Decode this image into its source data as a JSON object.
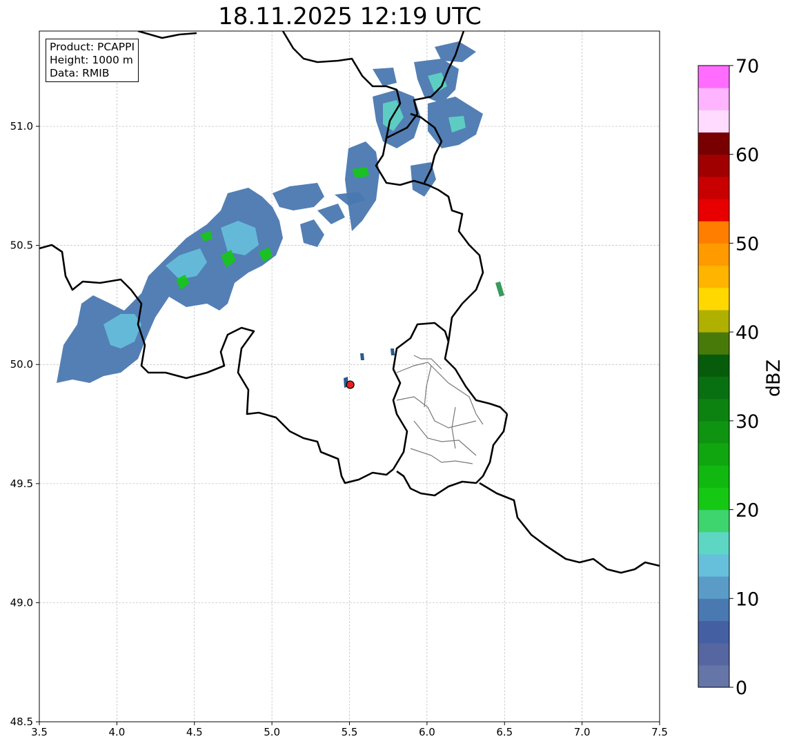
{
  "title": "18.11.2025 12:19 UTC",
  "info_box": [
    "Product: PCAPPI",
    "Height: 1000 m",
    "Data: RMIB"
  ],
  "map": {
    "lon_range": [
      3.5,
      7.5
    ],
    "lat_range": [
      48.5,
      51.4
    ],
    "lon_ticks": [
      3.5,
      4.0,
      4.5,
      5.0,
      5.5,
      6.0,
      6.5,
      7.0,
      7.5
    ],
    "lon_tick_labels": [
      "3.5",
      "4.0",
      "4.5",
      "5.0",
      "5.5",
      "6.0",
      "6.5",
      "7.0",
      "7.5"
    ],
    "lat_ticks": [
      48.5,
      49.0,
      49.5,
      50.0,
      50.5,
      51.0
    ],
    "lat_tick_labels": [
      "48.5",
      "49.0",
      "49.5",
      "50.0",
      "50.5",
      "51.0"
    ],
    "gridlines": true,
    "radar_site": {
      "lon": 5.505,
      "lat": 49.915,
      "color": "#e8201c"
    }
  },
  "colorbar": {
    "label": "dBZ",
    "vmin": 0,
    "vmax": 70,
    "step": 2.5,
    "tick_values": [
      0,
      10,
      20,
      30,
      40,
      50,
      60,
      70
    ],
    "tick_labels": [
      "0",
      "10",
      "20",
      "30",
      "40",
      "50",
      "60",
      "70"
    ],
    "colors": [
      "#6675a8",
      "#5566a0",
      "#4460a3",
      "#4a78b0",
      "#5a9bc8",
      "#66c0dc",
      "#5ed6c4",
      "#3ed46e",
      "#14c814",
      "#10b810",
      "#10a610",
      "#0e9410",
      "#0c8210",
      "#087010",
      "#065c0a",
      "#487a0a",
      "#b0b000",
      "#ffd800",
      "#ffb400",
      "#ff9a00",
      "#ff7e00",
      "#e80000",
      "#c80000",
      "#a00000",
      "#780000",
      "#ffdcff",
      "#ffb4ff",
      "#ff6cff",
      "#ee36ee"
    ]
  }
}
